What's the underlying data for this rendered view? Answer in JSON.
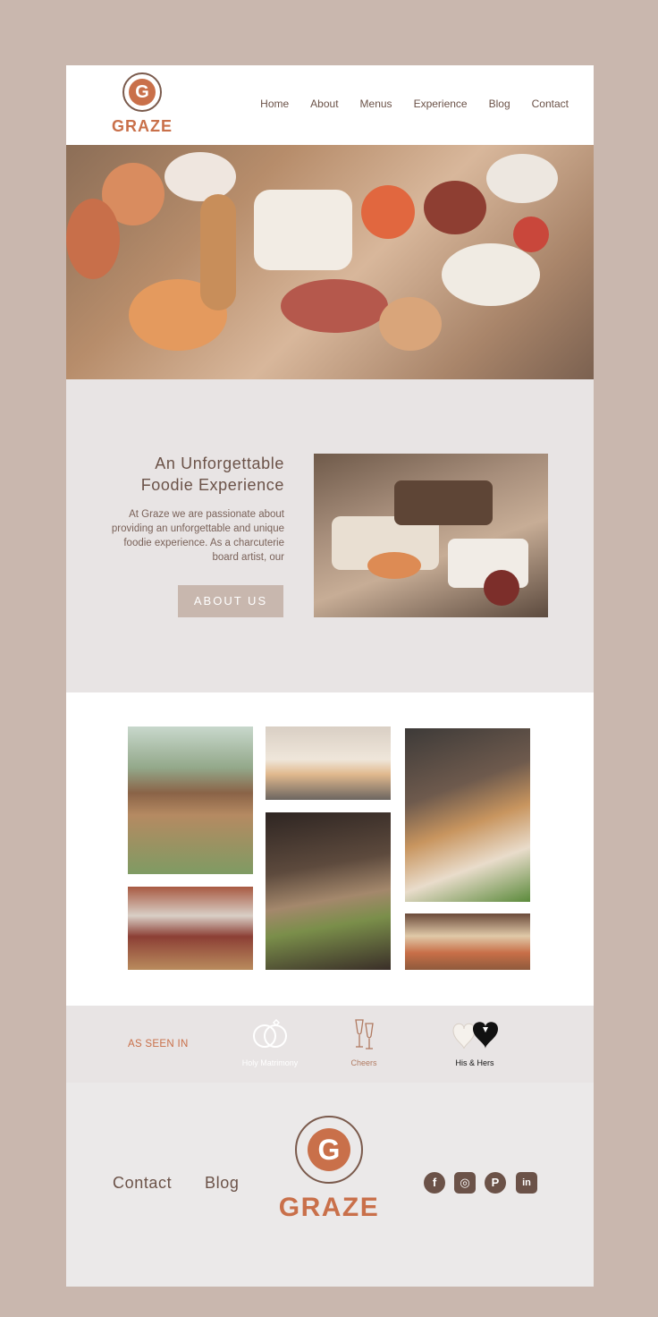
{
  "header": {
    "logo_letter": "G",
    "logo_text": "GRAZE",
    "nav": [
      "Home",
      "About",
      "Menus",
      "Experience",
      "Blog",
      "Contact"
    ]
  },
  "about": {
    "title_line1": "An Unforgettable",
    "title_line2": "Foodie Experience",
    "text": "At Graze we are passionate about providing an unforgettable and unique foodie experience. As a charcuterie board artist, our",
    "button": "ABOUT US"
  },
  "seen_in": {
    "label": "AS SEEN IN",
    "publications": [
      "Holy Matrimony",
      "Cheers",
      "His & Hers"
    ]
  },
  "footer": {
    "links": [
      "Contact",
      "Blog"
    ],
    "logo_letter": "G",
    "logo_text": "GRAZE",
    "social_icons": [
      "facebook-icon",
      "instagram-icon",
      "pinterest-icon",
      "linkedin-icon"
    ]
  },
  "colors": {
    "accent": "#c9704a",
    "brown": "#6b5248",
    "background": "#c9b7ae",
    "panel": "#e8e4e4"
  }
}
